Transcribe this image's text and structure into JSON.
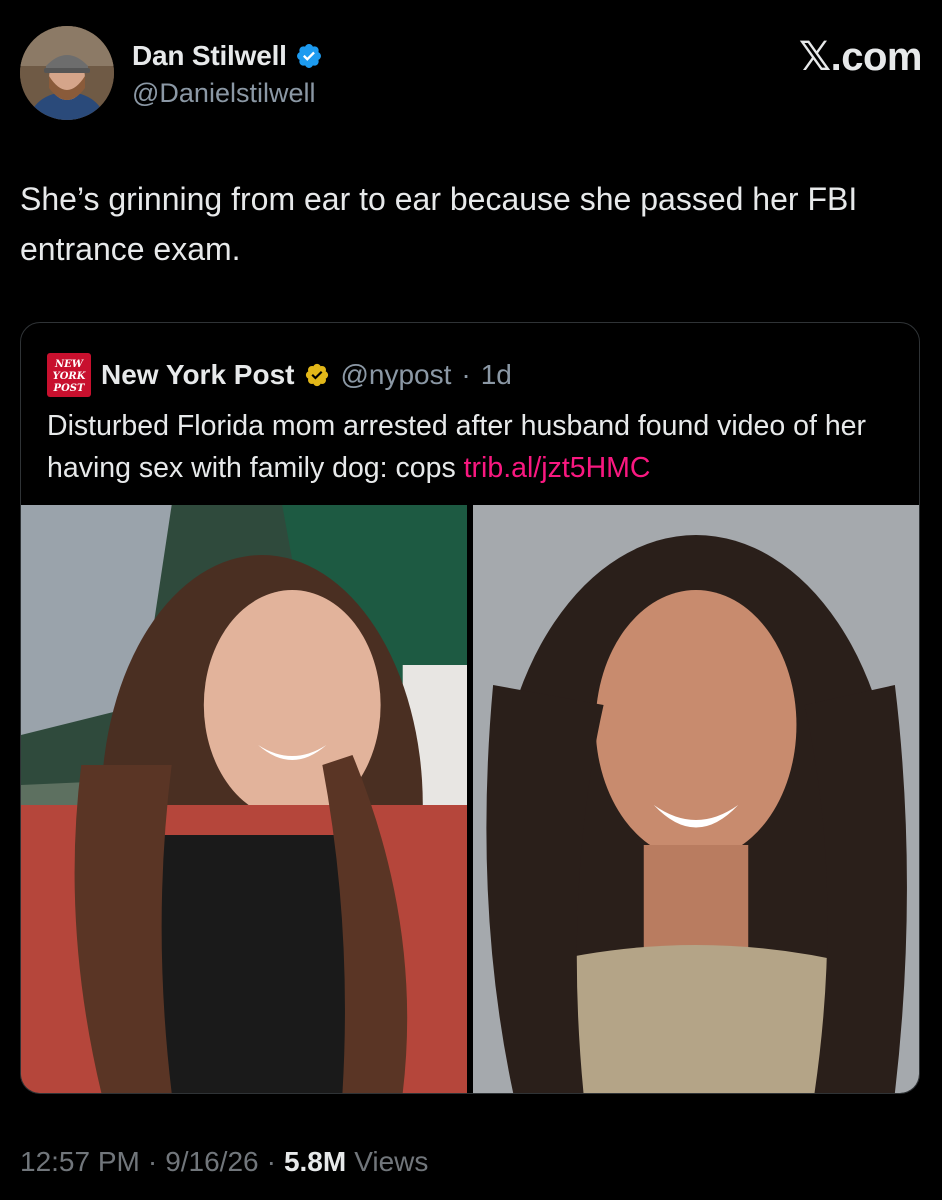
{
  "tweet": {
    "author": {
      "display_name": "Dan Stilwell",
      "handle": "@Danielstilwell",
      "verified_badge": "blue-verified-icon"
    },
    "source_mark": "𝕏.com",
    "text": "She’s grinning from ear to ear because she passed her FBI entrance exam.",
    "quote": {
      "author_name": "New York Post",
      "handle": "@nypost",
      "separator": "·",
      "time": "1d",
      "logo_text": [
        "NEW",
        "YORK",
        "POST"
      ],
      "verified_badge": "gold-verified-icon",
      "text": "Disturbed Florida mom arrested after husband found video of her having sex with family dog: cops ",
      "link": "trib.al/jzt5HMC",
      "link_color": "#f91880"
    },
    "footer": {
      "time": "12:57 PM",
      "sep1": "·",
      "date": "9/16/26",
      "sep2": "·",
      "views_count": "5.8M",
      "views_label": "Views"
    }
  },
  "colors": {
    "background": "#000000",
    "text_primary": "#e7e9ea",
    "text_secondary": "#8b98a5",
    "verified_blue": "#1d9bf0",
    "verified_gold": "#e2b719",
    "border": "#2f3336",
    "nypost_red": "#c8102e"
  }
}
